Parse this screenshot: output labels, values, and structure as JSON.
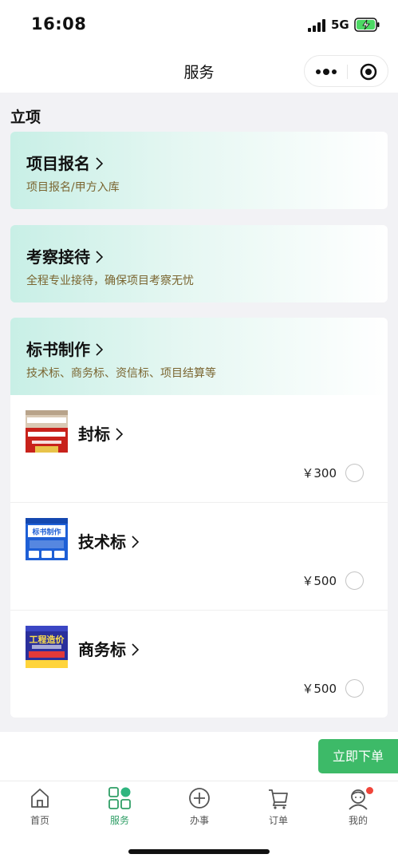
{
  "status_bar": {
    "time": "16:08",
    "network": "5G"
  },
  "nav": {
    "title": "服务"
  },
  "section": {
    "title": "立项"
  },
  "cards": [
    {
      "title": "项目报名",
      "subtitle": "项目报名/甲方入库"
    },
    {
      "title": "考察接待",
      "subtitle": "全程专业接待，确保项目考察无忧"
    },
    {
      "title": "标书制作",
      "subtitle": "技术标、商务标、资信标、项目结算等"
    }
  ],
  "products": [
    {
      "name": "封标",
      "price": "￥300",
      "thumb_icon": "sealed-bid-thumbnail"
    },
    {
      "name": "技术标",
      "price": "￥500",
      "thumb_icon": "technical-bid-thumbnail",
      "thumb_title": "标书制作"
    },
    {
      "name": "商务标",
      "price": "￥500",
      "thumb_icon": "business-bid-thumbnail",
      "thumb_title": "工程造价"
    }
  ],
  "order_button": "立即下单",
  "tabs": [
    {
      "label": "首页",
      "icon": "home-icon"
    },
    {
      "label": "服务",
      "icon": "services-grid-icon",
      "active": true
    },
    {
      "label": "办事",
      "icon": "add-circle-icon"
    },
    {
      "label": "订单",
      "icon": "cart-icon"
    },
    {
      "label": "我的",
      "icon": "profile-icon",
      "badge": true
    }
  ],
  "colors": {
    "accent": "#3dba68",
    "tab_active": "#2f9e66",
    "card_gradient_start": "#c8efe6",
    "subtitle_text": "#7a6530",
    "badge": "#f0453a"
  }
}
